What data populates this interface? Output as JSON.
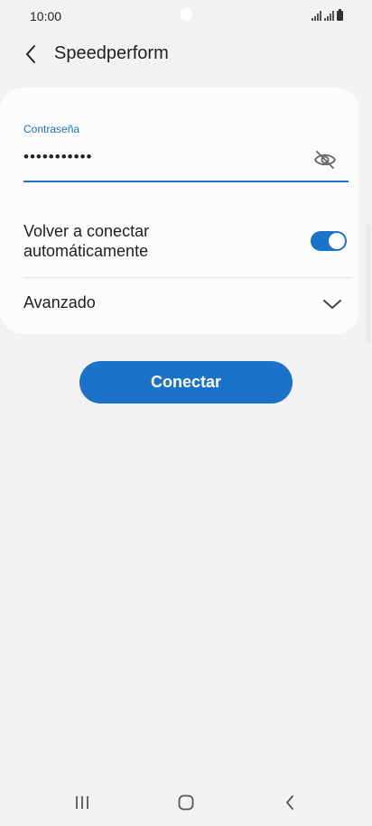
{
  "status_bar": {
    "time": "10:00"
  },
  "header": {
    "back_icon": "chevron-left-icon",
    "title": "Speedperform"
  },
  "password": {
    "label": "Contraseña",
    "value": "•••••••••••",
    "visibility_icon": "eye-off-icon"
  },
  "autoconnect": {
    "label": "Volver a conectar automáticamente",
    "enabled": true
  },
  "advanced": {
    "label": "Avanzado",
    "icon": "chevron-down-icon"
  },
  "connect_button": {
    "label": "Conectar"
  },
  "nav_bar": {
    "recents_icon": "recents-icon",
    "home_icon": "home-icon",
    "back_icon": "back-icon"
  },
  "colors": {
    "accent": "#1a73c8",
    "background": "#f2f2f2",
    "card": "#fcfcfc"
  }
}
